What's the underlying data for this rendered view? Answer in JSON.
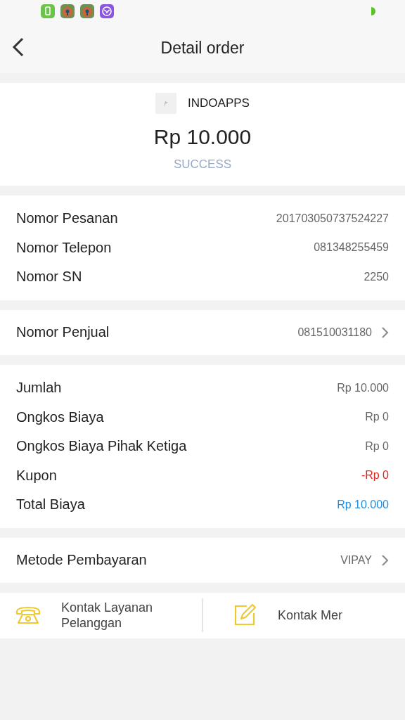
{
  "header": {
    "title": "Detail order"
  },
  "merchant": {
    "name": "INDOAPPS",
    "amount": "Rp 10.000",
    "status": "SUCCESS"
  },
  "order_info": [
    {
      "label": "Nomor Pesanan",
      "value": "201703050737524227"
    },
    {
      "label": "Nomor Telepon",
      "value": "081348255459"
    },
    {
      "label": "Nomor SN",
      "value": "2250"
    }
  ],
  "seller": {
    "label": "Nomor Penjual",
    "value": "081510031180"
  },
  "costs": [
    {
      "label": "Jumlah",
      "value": "Rp 10.000",
      "color": "#666666"
    },
    {
      "label": "Ongkos Biaya",
      "value": "Rp 0",
      "color": "#666666"
    },
    {
      "label": "Ongkos Biaya Pihak Ketiga",
      "value": "Rp 0",
      "color": "#666666"
    },
    {
      "label": "Kupon",
      "value": "-Rp 0",
      "color": "#e0231c"
    },
    {
      "label": "Total Biaya",
      "value": "Rp 10.000",
      "color": "#1f8ee0"
    }
  ],
  "payment": {
    "label": "Metode Pembayaran",
    "value": "VIPAY"
  },
  "contacts": [
    {
      "kind": "phone",
      "label": "Kontak Layanan Pelanggan"
    },
    {
      "kind": "edit",
      "label": "Kontak Mer"
    }
  ]
}
